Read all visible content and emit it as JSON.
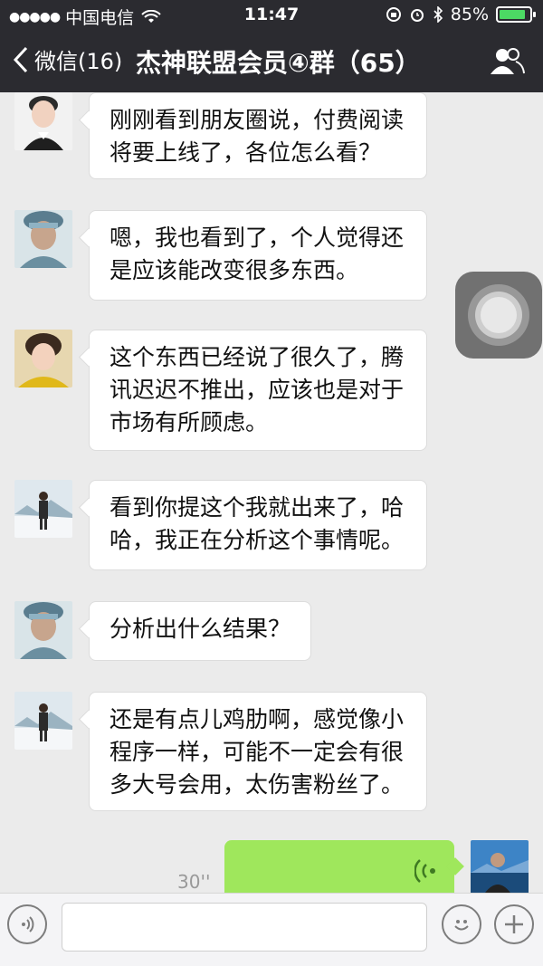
{
  "status_bar": {
    "carrier": "中国电信",
    "time": "11:47",
    "battery": "85%"
  },
  "nav": {
    "back_label": "微信(16)",
    "title": "杰神联盟会员④群（65）"
  },
  "messages": [
    {
      "text_lines": [
        "刚刚看到朋友圈说，付费阅读",
        "将要上线了，各位怎么看？"
      ]
    },
    {
      "text_lines": [
        "嗯，我也看到了，个人觉得还",
        "是应该能改变很多东西。"
      ]
    },
    {
      "text_lines": [
        "这个东西已经说了很久了，腾",
        "讯迟迟不推出，应该也是对于",
        "市场有所顾虑。"
      ]
    },
    {
      "text_lines": [
        "看到你提这个我就出来了，哈",
        "哈，我正在分析这个事情呢。"
      ]
    },
    {
      "text_lines": [
        "分析出什么结果？"
      ]
    },
    {
      "text_lines": [
        "还是有点儿鸡肋啊，感觉像小",
        "程序一样，可能不一定会有很",
        "多大号会用，太伤害粉丝了。"
      ]
    }
  ],
  "voice_message": {
    "duration": "30''"
  },
  "input_bar": {
    "text_value": ""
  },
  "icons": {
    "back": "chevron-left-icon",
    "contacts": "group-contacts-icon",
    "voice": "voice-mode-icon",
    "emoji": "emoji-icon",
    "add": "plus-icon"
  }
}
